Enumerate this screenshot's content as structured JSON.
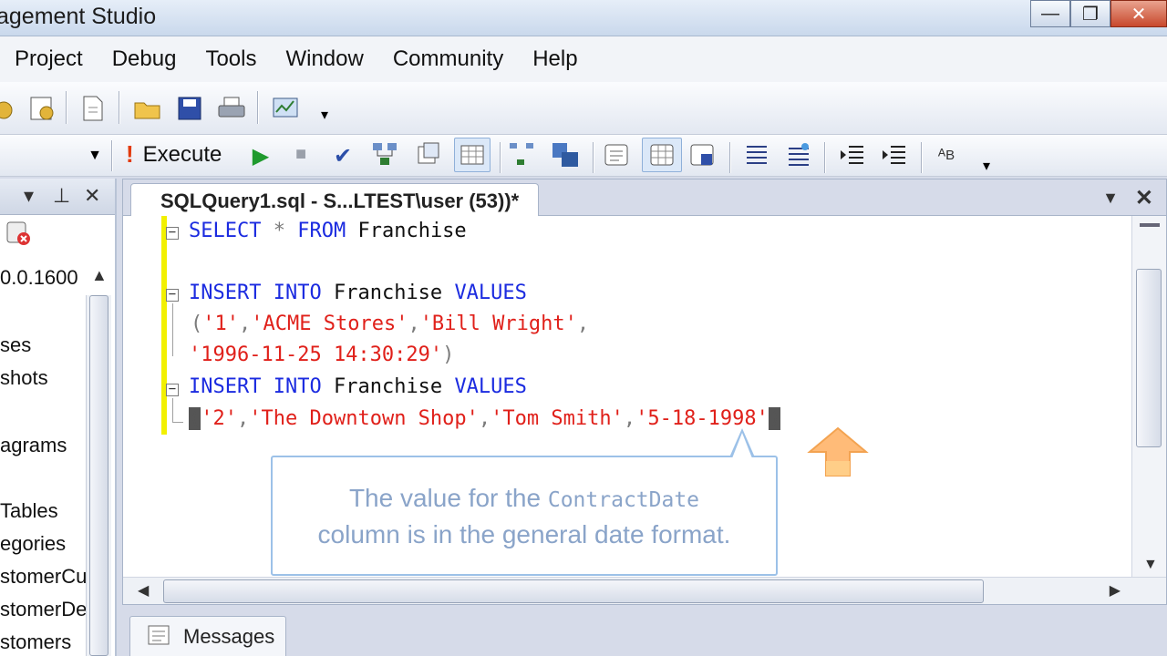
{
  "window": {
    "title": "agement Studio",
    "min": "—",
    "max": "❐",
    "close": "✕"
  },
  "menu": [
    "Project",
    "Debug",
    "Tools",
    "Window",
    "Community",
    "Help"
  ],
  "toolbar": {
    "execute_label": "Execute"
  },
  "object_explorer": {
    "version": "0.0.1600",
    "items": [
      "ses",
      "shots",
      "agrams",
      "Tables",
      "egories",
      "stomerCu",
      "stomerDe",
      "stomers"
    ]
  },
  "document": {
    "tab_title": "SQLQuery1.sql - S...LTEST\\user (53))*"
  },
  "code": {
    "l1": {
      "kw1": "SELECT",
      "op": "*",
      "kw2": "FROM",
      "name": "Franchise"
    },
    "l2": {
      "kw1": "INSERT",
      "kw2": "INTO",
      "name": "Franchise",
      "kw3": "VALUES"
    },
    "l3": {
      "open": "(",
      "v1": "'1'",
      "c1": ",",
      "v2": "'ACME Stores'",
      "c2": ",",
      "v3": "'Bill Wright'",
      "c3": ","
    },
    "l4": {
      "v4": "'1996-11-25 14:30:29'",
      "close": ")"
    },
    "l5": {
      "kw1": "INSERT",
      "kw2": "INTO",
      "name": "Franchise",
      "kw3": "VALUES"
    },
    "l6": {
      "open": "(",
      "v1": "'2'",
      "c1": ",",
      "v2": "'The Downtown Shop'",
      "c2": ",",
      "v3": "'Tom Smith'",
      "c3": ",",
      "v4": "'5-18-1998'",
      "close": ")"
    }
  },
  "callout": {
    "part1": "The value for the ",
    "mono": "ContractDate",
    "part2": "column is in the general date format."
  },
  "bottom": {
    "messages_label": "Messages"
  },
  "colors": {
    "keyword": "#1b2be0",
    "string": "#e0201a",
    "callout_text": "#8aa4c9"
  }
}
